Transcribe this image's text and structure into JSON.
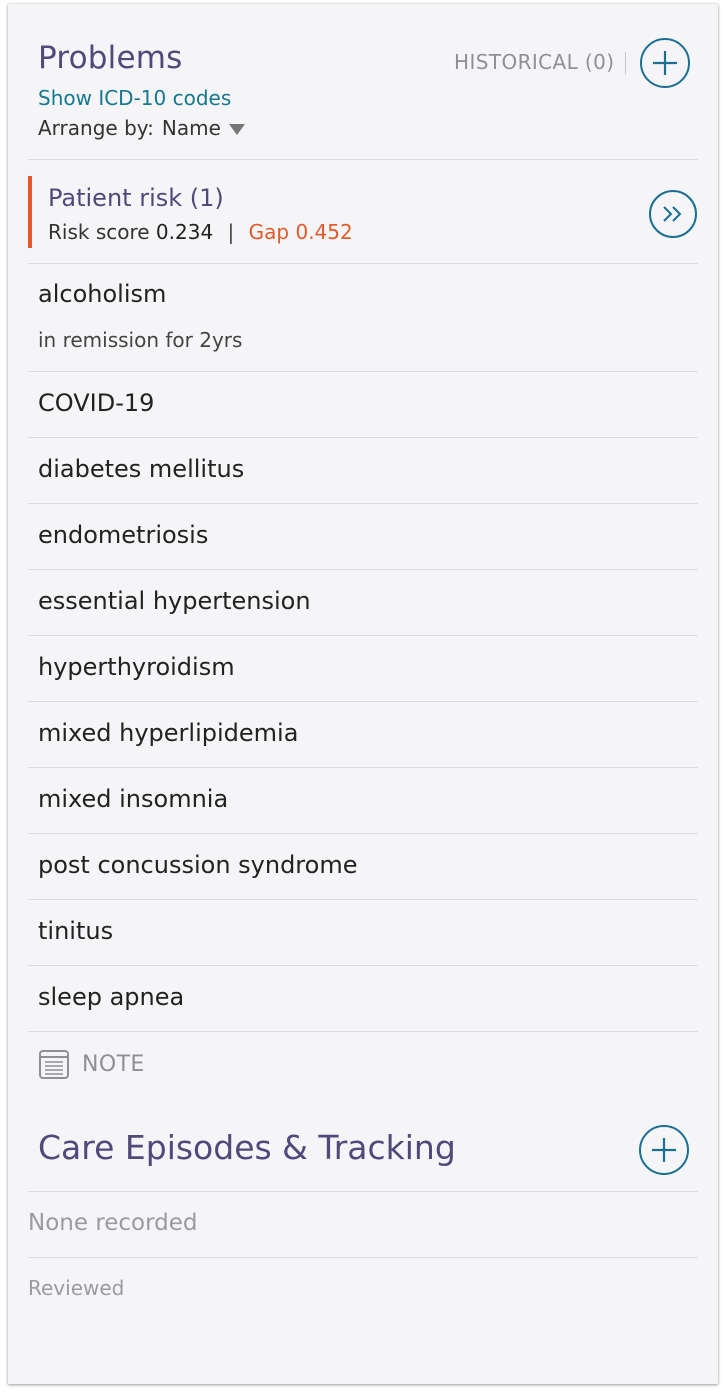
{
  "problems": {
    "title": "Problems",
    "icd_link": "Show ICD-10 codes",
    "arrange_label": "Arrange by:",
    "arrange_value": "Name",
    "historical": "HISTORICAL (0)"
  },
  "risk": {
    "title": "Patient risk (1)",
    "score_label": "Risk score",
    "score_value": "0.234",
    "separator": "|",
    "gap_label": "Gap",
    "gap_value": "0.452"
  },
  "items": [
    {
      "name": "alcoholism",
      "note": "in remission for 2yrs"
    },
    {
      "name": "COVID-19"
    },
    {
      "name": "diabetes mellitus"
    },
    {
      "name": "endometriosis"
    },
    {
      "name": "essential hypertension"
    },
    {
      "name": "hyperthyroidism"
    },
    {
      "name": "mixed hyperlipidemia"
    },
    {
      "name": "mixed insomnia"
    },
    {
      "name": "post concussion syndrome"
    },
    {
      "name": "tinitus"
    },
    {
      "name": "sleep apnea"
    }
  ],
  "note": {
    "label": "NOTE"
  },
  "care": {
    "title": "Care Episodes & Tracking",
    "none": "None recorded",
    "reviewed": "Reviewed"
  },
  "icons": {
    "add": "plus-circle-icon",
    "next": "double-chevron-right-icon",
    "arrange": "triangle-down-icon",
    "note": "note-icon"
  },
  "colors": {
    "heading": "#4f4a7a",
    "link": "#14788f",
    "accent": "#1a6f92",
    "risk": "#e25a2a"
  }
}
